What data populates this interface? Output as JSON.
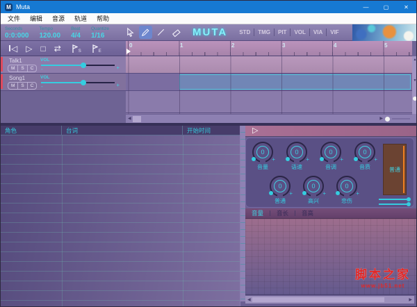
{
  "window": {
    "title": "Muta",
    "icon_letter": "M",
    "controls": {
      "minimize": "—",
      "maximize": "▢",
      "close": "✕"
    }
  },
  "menu": {
    "items": [
      {
        "label": "文件"
      },
      {
        "label": "编辑"
      },
      {
        "label": "音源"
      },
      {
        "label": "轨道"
      },
      {
        "label": "帮助"
      }
    ]
  },
  "toolbar": {
    "fields": [
      {
        "label": "Seconds",
        "value": "0:0:000"
      },
      {
        "label": "Tempo",
        "value": "120.00"
      },
      {
        "label": "Beat",
        "value": "4/4"
      },
      {
        "label": "Quantize",
        "value": "1/16"
      }
    ],
    "logo": "MUTA",
    "modes": [
      {
        "label": "STD"
      },
      {
        "label": "TMG"
      },
      {
        "label": "PIT"
      },
      {
        "label": "VOL"
      },
      {
        "label": "VIA"
      },
      {
        "label": "VIF"
      }
    ]
  },
  "transport": {
    "icons": {
      "skip_to_start": "◁",
      "play": "▷",
      "stop": "□",
      "loop": "⇄"
    },
    "markers": {
      "start_label": "S",
      "end_label": "E"
    }
  },
  "ruler": {
    "marks": [
      "0",
      "1",
      "2",
      "3",
      "4",
      "5"
    ]
  },
  "tracks": [
    {
      "name": "Talk1",
      "vol_label": "VOL",
      "buttons": [
        "M",
        "S",
        "C"
      ]
    },
    {
      "name": "Song1",
      "vol_label": "VOL",
      "buttons": [
        "M",
        "S",
        "C"
      ]
    }
  ],
  "dialog_table": {
    "columns": [
      {
        "label": "角色"
      },
      {
        "label": "台词"
      },
      {
        "label": "开始时间"
      }
    ]
  },
  "editor": {
    "play_icon": "▷",
    "knobs_row1": [
      {
        "label": "音量",
        "value": "0"
      },
      {
        "label": "语速",
        "value": "0"
      },
      {
        "label": "音调",
        "value": "0"
      },
      {
        "label": "音质",
        "value": "0"
      }
    ],
    "knobs_row2": [
      {
        "label": "普通",
        "value": "0"
      },
      {
        "label": "高兴",
        "value": "0"
      },
      {
        "label": "悲伤",
        "value": "0"
      }
    ],
    "fader": {
      "label": "普通"
    },
    "tabs": [
      {
        "label": "音量",
        "active": true
      },
      {
        "label": "音长",
        "active": false
      },
      {
        "label": "音高",
        "active": false
      }
    ]
  },
  "icons": {
    "left": "◀",
    "right": "▶",
    "up": "▲",
    "down": "▼",
    "plus": "+",
    "minus": "-"
  },
  "watermark": {
    "title": "脚本之家",
    "url": "www.jb51.net"
  },
  "colors": {
    "titlebar": "#1679d2",
    "accent_cyan": "#3fd2e2",
    "clip_fill": "#7186b6",
    "clip_border": "#4cc8dc",
    "track_marker_red": "#df4a5e",
    "watermark_red": "#e02828"
  }
}
